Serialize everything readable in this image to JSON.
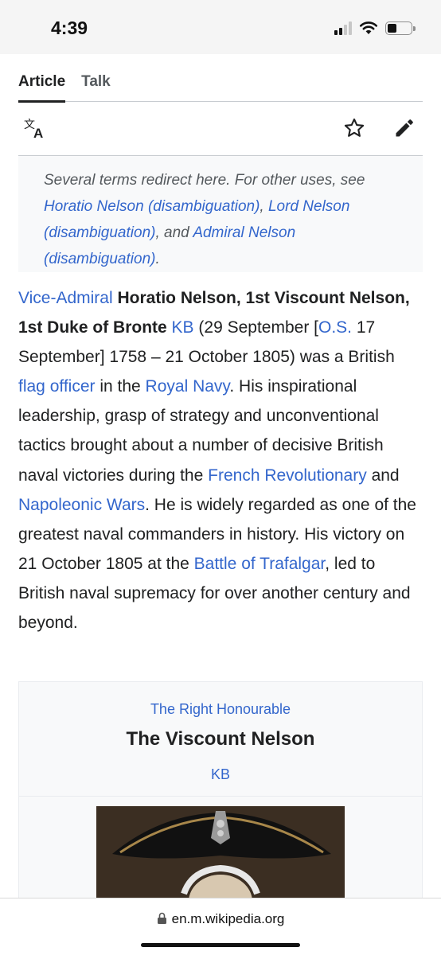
{
  "status_bar": {
    "time": "4:39",
    "signal_bars_active": 2,
    "signal_bars_total": 4,
    "battery_level": 0.4,
    "icons": [
      "signal-icon",
      "wifi-icon",
      "battery-icon"
    ]
  },
  "tabs": [
    {
      "label": "Article",
      "active": true
    },
    {
      "label": "Talk",
      "active": false
    }
  ],
  "toolbar": {
    "icons": [
      "language-icon",
      "star-icon",
      "edit-icon"
    ]
  },
  "hatnote": {
    "intro": "Several terms redirect here. For other uses, see ",
    "link1": "Horatio Nelson (disambiguation)",
    "sep1": ", ",
    "link2": "Lord Nelson (disambiguation)",
    "sep2": ", and ",
    "link3": "Admiral Nelson (disambiguation)",
    "end": "."
  },
  "lead": {
    "link_vice_admiral": "Vice-Admiral",
    "name_bold": "Horatio Nelson, 1st Viscount Nelson, 1st Duke of Bronte",
    "link_kb": "KB",
    "text1": " (29 September [",
    "link_os": "O.S.",
    "text2": " 17 September] 1758 – 21 October 1805) was a British ",
    "link_flag_officer": "flag officer",
    "text3": " in the ",
    "link_royal_navy": "Royal Navy",
    "text4": ". His inspirational leadership, grasp of strategy and unconventional tactics brought about a number of decisive British naval victories during the ",
    "link_french_rev": "French Revolutionary",
    "text5": " and ",
    "link_napoleonic": "Napoleonic Wars",
    "text6": ". He is widely regarded as one of the greatest naval commanders in history. His victory on 21 October 1805 at the ",
    "link_trafalgar": "Battle of Trafalgar",
    "text7": ", led to British naval supremacy for over another century and beyond."
  },
  "infobox": {
    "honorific": "The Right Honourable",
    "name": "The Viscount Nelson",
    "post_nominal": "KB"
  },
  "browser": {
    "url": "en.m.wikipedia.org"
  },
  "colors": {
    "link": "#3366cc",
    "text": "#202122",
    "muted": "#54595d",
    "hatnote_bg": "#f8f9fa",
    "border": "#c8ccd1"
  }
}
